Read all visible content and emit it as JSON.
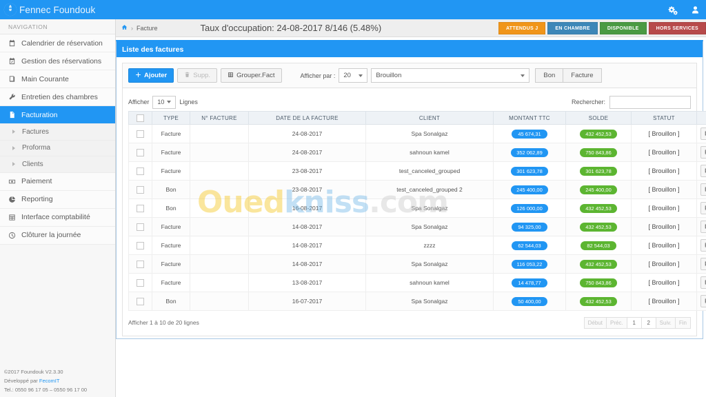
{
  "app": {
    "brand": "Fennec Foundouk",
    "logo_icon": "fennec-globe-logo"
  },
  "topbar": {
    "settings_icon": "gears-icon",
    "user_icon": "user-icon"
  },
  "sidebar": {
    "nav_title": "NAVIGATION",
    "items": [
      {
        "label": "Calendrier de réservation",
        "icon": "calendar-icon",
        "active": false
      },
      {
        "label": "Gestion des réservations",
        "icon": "calendar-check-icon",
        "active": false
      },
      {
        "label": "Main Courante",
        "icon": "book-icon",
        "active": false
      },
      {
        "label": "Entretien des chambres",
        "icon": "wrench-icon",
        "active": false
      },
      {
        "label": "Facturation",
        "icon": "file-invoice-icon",
        "active": true
      }
    ],
    "sub_items": [
      {
        "label": "Factures",
        "icon": "chevron-right-icon"
      },
      {
        "label": "Proforma",
        "icon": "chevron-right-icon"
      },
      {
        "label": "Clients",
        "icon": "chevron-right-icon"
      }
    ],
    "items_after": [
      {
        "label": "Paiement",
        "icon": "money-icon",
        "active": false
      },
      {
        "label": "Reporting",
        "icon": "pie-chart-icon",
        "active": false
      },
      {
        "label": "Interface comptabilité",
        "icon": "ledger-icon",
        "active": false
      },
      {
        "label": "Clôturer la journée",
        "icon": "clock-icon",
        "active": false
      }
    ]
  },
  "footer": {
    "copyright": "©2017 Foundouk V2.3.30",
    "developed_prefix": "Développé par ",
    "developed_by": "FecomIT",
    "phone": "Tel.: 0550 96 17 05 – 0550 96 17 00"
  },
  "breadcrumb": {
    "home_icon": "home-icon",
    "separator": "›",
    "current": "Facture"
  },
  "occupancy": {
    "text": "Taux d'occupation: 24-08-2017  8/146 (5.48%)"
  },
  "status_badges": [
    {
      "label": "ATTENDUS J",
      "color": "#f0951a"
    },
    {
      "label": "EN CHAMBRE",
      "color": "#3d87b8"
    },
    {
      "label": "DISPONIBLE",
      "color": "#4a9a43"
    },
    {
      "label": "HORS SERVICES",
      "color": "#b74a4a"
    }
  ],
  "panel": {
    "title": "Liste des factures"
  },
  "toolbar": {
    "add_label": "Ajouter",
    "add_icon": "plus-icon",
    "delete_label": "Supp.",
    "delete_icon": "trash-icon",
    "group_label": "Grouper.Fact",
    "group_icon": "grid-icon",
    "afficher_par_label": "Afficher par :",
    "per_page_value": "20",
    "state_value": "Brouillon",
    "bon_label": "Bon",
    "facture_label": "Facture"
  },
  "table_controls": {
    "afficher_label": "Afficher",
    "lignes_label": "Lignes",
    "page_len_value": "10",
    "search_label": "Rechercher:",
    "search_value": "",
    "search_placeholder": ""
  },
  "table": {
    "columns": [
      "",
      "TYPE",
      "N° FACTURE",
      "DATE DE LA FACTURE",
      "CLIENT",
      "MONTANT TTC",
      "SOLDE",
      "STATUT",
      ""
    ],
    "action_icon": "grid-dropdown-icon",
    "rows": [
      {
        "type": "Facture",
        "num": "",
        "date": "24-08-2017",
        "client": "Spa Sonalgaz",
        "montant": "45 674,31",
        "solde": "432 452,53",
        "statut": "[ Brouillon ]"
      },
      {
        "type": "Facture",
        "num": "",
        "date": "24-08-2017",
        "client": "sahnoun kamel",
        "montant": "352 062,89",
        "solde": "750 843,86",
        "statut": "[ Brouillon ]"
      },
      {
        "type": "Facture",
        "num": "",
        "date": "23-08-2017",
        "client": "test_canceled_grouped",
        "montant": "301 623,78",
        "solde": "301 623,78",
        "statut": "[ Brouillon ]"
      },
      {
        "type": "Bon",
        "num": "",
        "date": "23-08-2017",
        "client": "test_canceled_grouped 2",
        "montant": "245 400,00",
        "solde": "245 400,00",
        "statut": "[ Brouillon ]"
      },
      {
        "type": "Bon",
        "num": "",
        "date": "16-08-2017",
        "client": "Spa Sonalgaz",
        "montant": "126 000,00",
        "solde": "432 452,53",
        "statut": "[ Brouillon ]"
      },
      {
        "type": "Facture",
        "num": "",
        "date": "14-08-2017",
        "client": "Spa Sonalgaz",
        "montant": "94 325,00",
        "solde": "432 452,53",
        "statut": "[ Brouillon ]"
      },
      {
        "type": "Facture",
        "num": "",
        "date": "14-08-2017",
        "client": "zzzz",
        "montant": "62 544,03",
        "solde": "82 544,03",
        "statut": "[ Brouillon ]"
      },
      {
        "type": "Facture",
        "num": "",
        "date": "14-08-2017",
        "client": "Spa Sonalgaz",
        "montant": "116 053,22",
        "solde": "432 452,53",
        "statut": "[ Brouillon ]"
      },
      {
        "type": "Facture",
        "num": "",
        "date": "13-08-2017",
        "client": "sahnoun kamel",
        "montant": "14 478,77",
        "solde": "750 843,86",
        "statut": "[ Brouillon ]"
      },
      {
        "type": "Bon",
        "num": "",
        "date": "16-07-2017",
        "client": "Spa Sonalgaz",
        "montant": "50 400,00",
        "solde": "432 452,53",
        "statut": "[ Brouillon ]"
      }
    ]
  },
  "pagination": {
    "info": "Afficher 1 à 10 de 20 lignes",
    "buttons": [
      "Début",
      "Préc.",
      "1",
      "2",
      "Suiv.",
      "Fin"
    ],
    "active": "1"
  },
  "watermark": {
    "part1": "Oued",
    "part2": "kniss",
    "part3": ".com"
  },
  "colors": {
    "brand_blue": "#2196f3",
    "pill_blue": "#2196f3",
    "pill_green": "#5cb531"
  }
}
